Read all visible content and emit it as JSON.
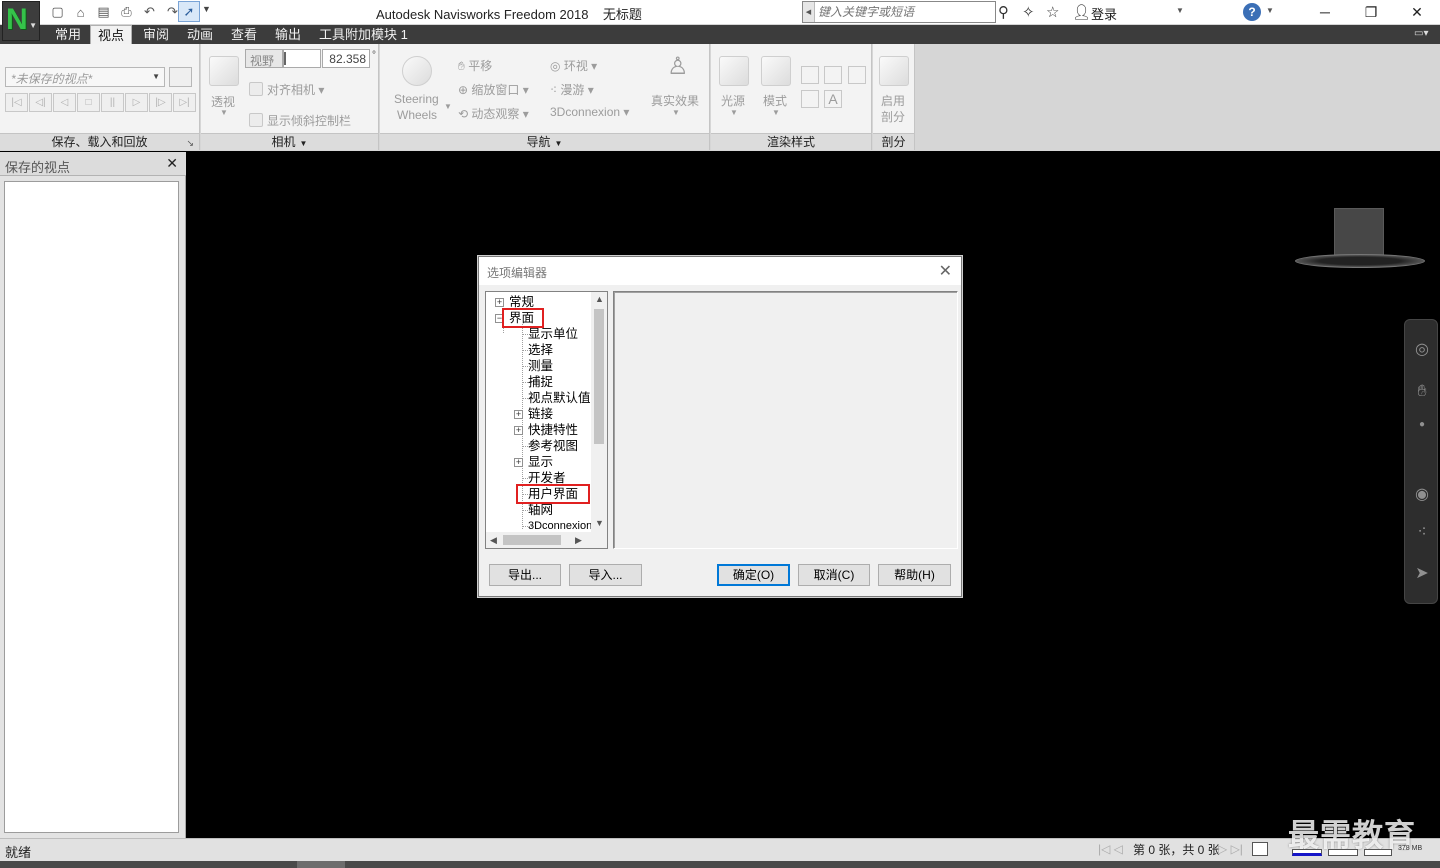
{
  "window": {
    "app_name": "Autodesk Navisworks Freedom 2018",
    "doc_title": "无标题",
    "search_placeholder": "键入关键字或短语",
    "login_label": "登录",
    "minimize_glyph": "─",
    "restore_glyph": "❐",
    "close_glyph": "✕",
    "app_logo_letter": "N"
  },
  "tabs": [
    {
      "label": "常用"
    },
    {
      "label": "视点"
    },
    {
      "label": "审阅"
    },
    {
      "label": "动画"
    },
    {
      "label": "查看"
    },
    {
      "label": "输出"
    },
    {
      "label": "工具附加模块 1"
    }
  ],
  "ribbon": {
    "save_panel": {
      "viewpoint_select": "*未保存的视点*",
      "label": "保存、载入和回放"
    },
    "camera_panel": {
      "perspective": "透视",
      "fov_label": "视野",
      "fov_value": "82.358",
      "fov_unit": "°",
      "align_camera": "对齐相机",
      "tilt_bar": "显示倾斜控制栏",
      "label": "相机"
    },
    "navigation_panel": {
      "steering_wheels_line1": "Steering",
      "steering_wheels_line2": "Wheels",
      "pan": "平移",
      "zoom_window": "缩放窗口",
      "orbit": "动态观察",
      "look_around": "环视",
      "walk": "漫游",
      "connexion": "3Dconnexion",
      "realism": "真实效果",
      "label": "导航"
    },
    "render_panel": {
      "lighting": "光源",
      "mode": "模式",
      "label": "渲染样式"
    },
    "section_panel": {
      "enable_line1": "启用",
      "enable_line2": "剖分",
      "label": "剖分"
    }
  },
  "left_panel": {
    "title": "保存的视点",
    "close_glyph": "✕"
  },
  "dialog": {
    "title": "选项编辑器",
    "close_glyph": "✕",
    "tree": [
      {
        "label": "常规"
      },
      {
        "label": "界面"
      },
      {
        "label": "显示单位"
      },
      {
        "label": "选择"
      },
      {
        "label": "测量"
      },
      {
        "label": "捕捉"
      },
      {
        "label": "视点默认值"
      },
      {
        "label": "链接"
      },
      {
        "label": "快捷特性"
      },
      {
        "label": "参考视图"
      },
      {
        "label": "显示"
      },
      {
        "label": "开发者"
      },
      {
        "label": "用户界面"
      },
      {
        "label": "轴网"
      },
      {
        "label": "3Dconnexion"
      }
    ],
    "buttons": {
      "export": "导出...",
      "import": "导入...",
      "ok": "确定(O)",
      "cancel": "取消(C)",
      "help": "帮助(H)"
    },
    "highlight_color": "#e02020"
  },
  "status": {
    "ready": "就绪",
    "sheet_info": "第 0 张，共 0 张",
    "memory": "378 MB",
    "watermark": "最需教育"
  },
  "colors": {
    "app_accent": "#35c24a",
    "tabbar_bg": "#3c3c3c",
    "viewport_bg": "#000000",
    "default_button_border": "#0078d7"
  }
}
